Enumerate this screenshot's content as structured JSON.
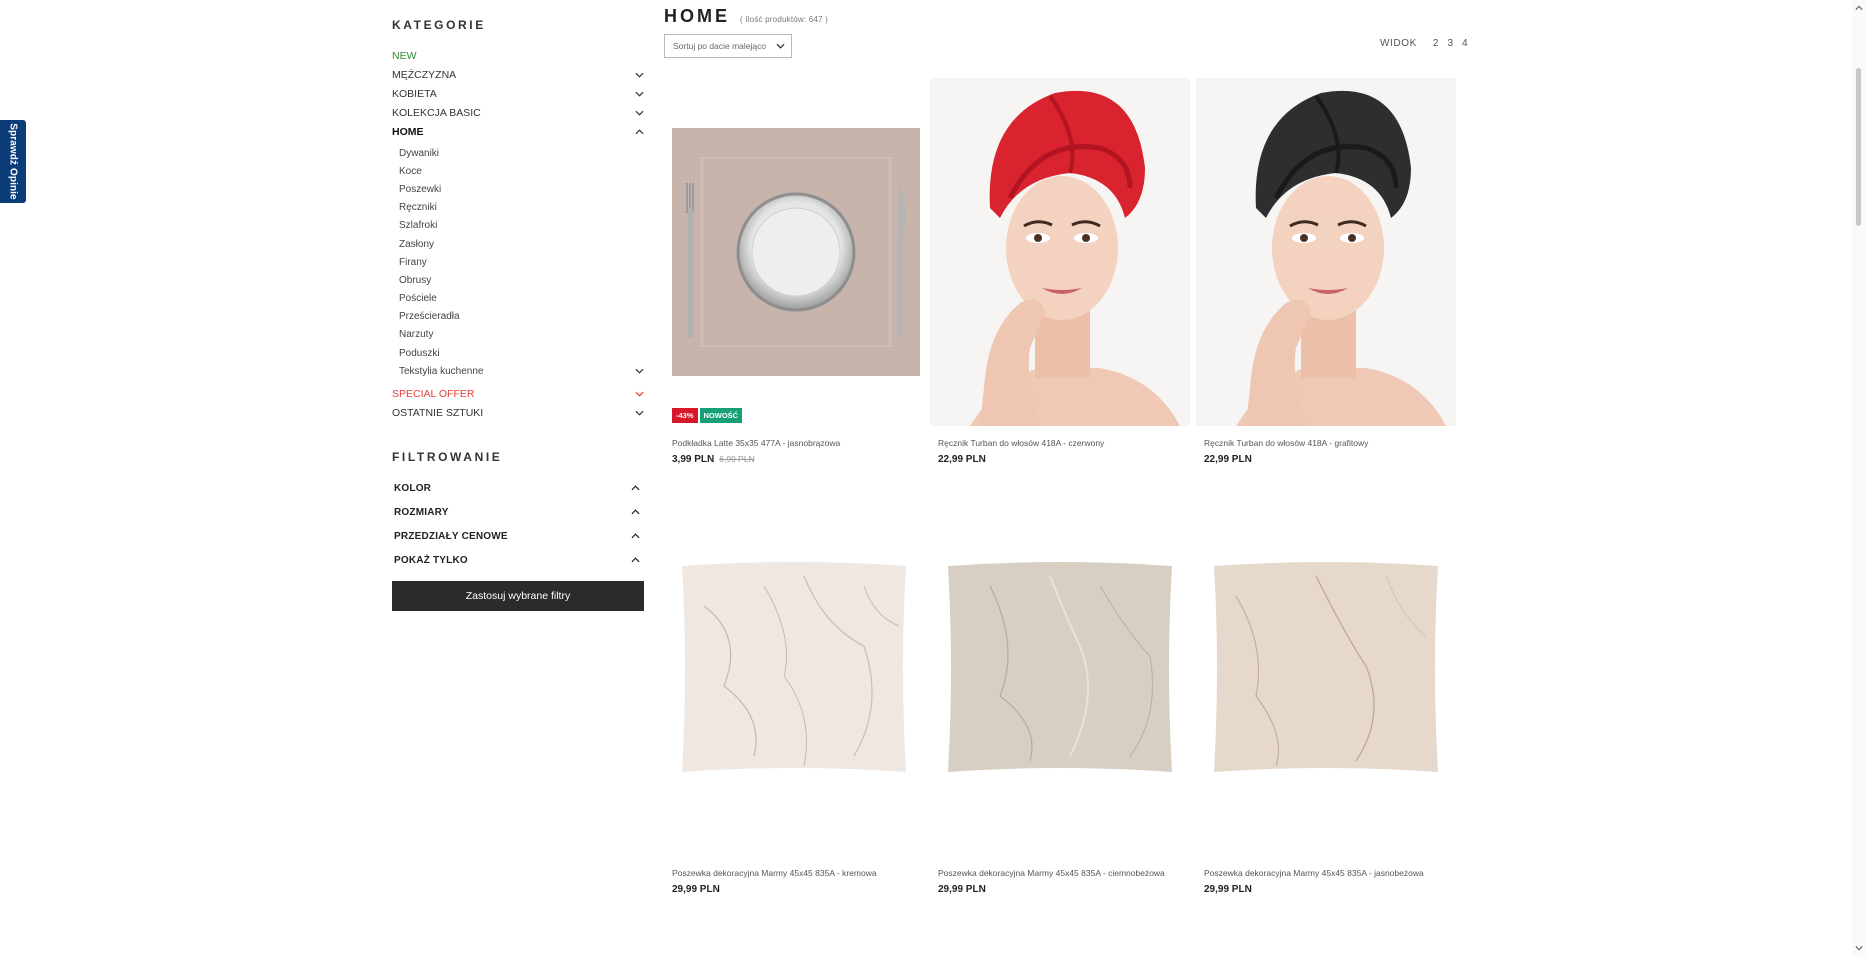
{
  "review_tab": {
    "label": "Sprawdź Opinie",
    "color": "#0b3c78"
  },
  "sidebar": {
    "categories_title": "KATEGORIE",
    "categories": [
      {
        "label": "NEW",
        "style": "new",
        "has_chevron": false
      },
      {
        "label": "MĘŻCZYZNA",
        "style": "normal",
        "has_chevron": true,
        "expanded": false
      },
      {
        "label": "KOBIETA",
        "style": "normal",
        "has_chevron": true,
        "expanded": false
      },
      {
        "label": "KOLEKCJA BASIC",
        "style": "normal",
        "has_chevron": true,
        "expanded": false
      },
      {
        "label": "HOME",
        "style": "bold",
        "has_chevron": true,
        "expanded": true
      }
    ],
    "home_subcategories": [
      {
        "label": "Dywaniki",
        "has_chevron": false
      },
      {
        "label": "Koce",
        "has_chevron": false
      },
      {
        "label": "Poszewki",
        "has_chevron": false
      },
      {
        "label": "Ręczniki",
        "has_chevron": false
      },
      {
        "label": "Szlafroki",
        "has_chevron": false
      },
      {
        "label": "Zasłony",
        "has_chevron": false
      },
      {
        "label": "Firany",
        "has_chevron": false
      },
      {
        "label": "Obrusy",
        "has_chevron": false
      },
      {
        "label": "Pościele",
        "has_chevron": false
      },
      {
        "label": "Prześcieradła",
        "has_chevron": false
      },
      {
        "label": "Narzuty",
        "has_chevron": false
      },
      {
        "label": "Poduszki",
        "has_chevron": false
      },
      {
        "label": "Tekstylia kuchenne",
        "has_chevron": true
      }
    ],
    "categories_after": [
      {
        "label": "SPECIAL OFFER",
        "style": "special",
        "has_chevron": true
      },
      {
        "label": "OSTATNIE SZTUKI",
        "style": "normal",
        "has_chevron": true
      }
    ],
    "filters_title": "FILTROWANIE",
    "filters": [
      {
        "label": "KOLOR"
      },
      {
        "label": "ROZMIARY"
      },
      {
        "label": "PRZEDZIAŁY CENOWE"
      },
      {
        "label": "POKAŻ TYLKO"
      }
    ],
    "apply_button": "Zastosuj wybrane filtry"
  },
  "main": {
    "title": "HOME",
    "count": "( Ilość produktów: 647 )",
    "sort_value": "Sortuj po dacie malejąco",
    "view_label": "WIDOK",
    "view_options": [
      "2",
      "3",
      "4"
    ]
  },
  "products": [
    {
      "name": "Podkładka Latte 35x35 477A - jasnobrązowa",
      "price": "3,99 PLN",
      "old_price": "6,99 PLN",
      "badges": [
        "-43%",
        "NOWOŚĆ"
      ],
      "image": "placemat"
    },
    {
      "name": "Ręcznik Turban do włosów 418A - czerwony",
      "price": "22,99 PLN",
      "old_price": "",
      "badges": [],
      "image": "turban-red"
    },
    {
      "name": "Ręcznik Turban do włosów 418A - grafitowy",
      "price": "22,99 PLN",
      "old_price": "",
      "badges": [],
      "image": "turban-graphite"
    },
    {
      "name": "Poszewka dekoracyjna Marmy 45x45 835A - kremowa",
      "price": "29,99 PLN",
      "old_price": "",
      "badges": [],
      "image": "pillow-cream"
    },
    {
      "name": "Poszewka dekoracyjna Marmy 45x45 835A - ciemnobeżowa",
      "price": "29,99 PLN",
      "old_price": "",
      "badges": [],
      "image": "pillow-darkbeige"
    },
    {
      "name": "Poszewka dekoracyjna Marmy 45x45 835A - jasnobeżowa",
      "price": "29,99 PLN",
      "old_price": "",
      "badges": [],
      "image": "pillow-lightbeige"
    }
  ],
  "colors": {
    "new": "#2e8b2e",
    "special": "#e8403a",
    "discount_badge": "#d7182a",
    "new_badge": "#17a078",
    "apply_button": "#2b2b2b"
  }
}
